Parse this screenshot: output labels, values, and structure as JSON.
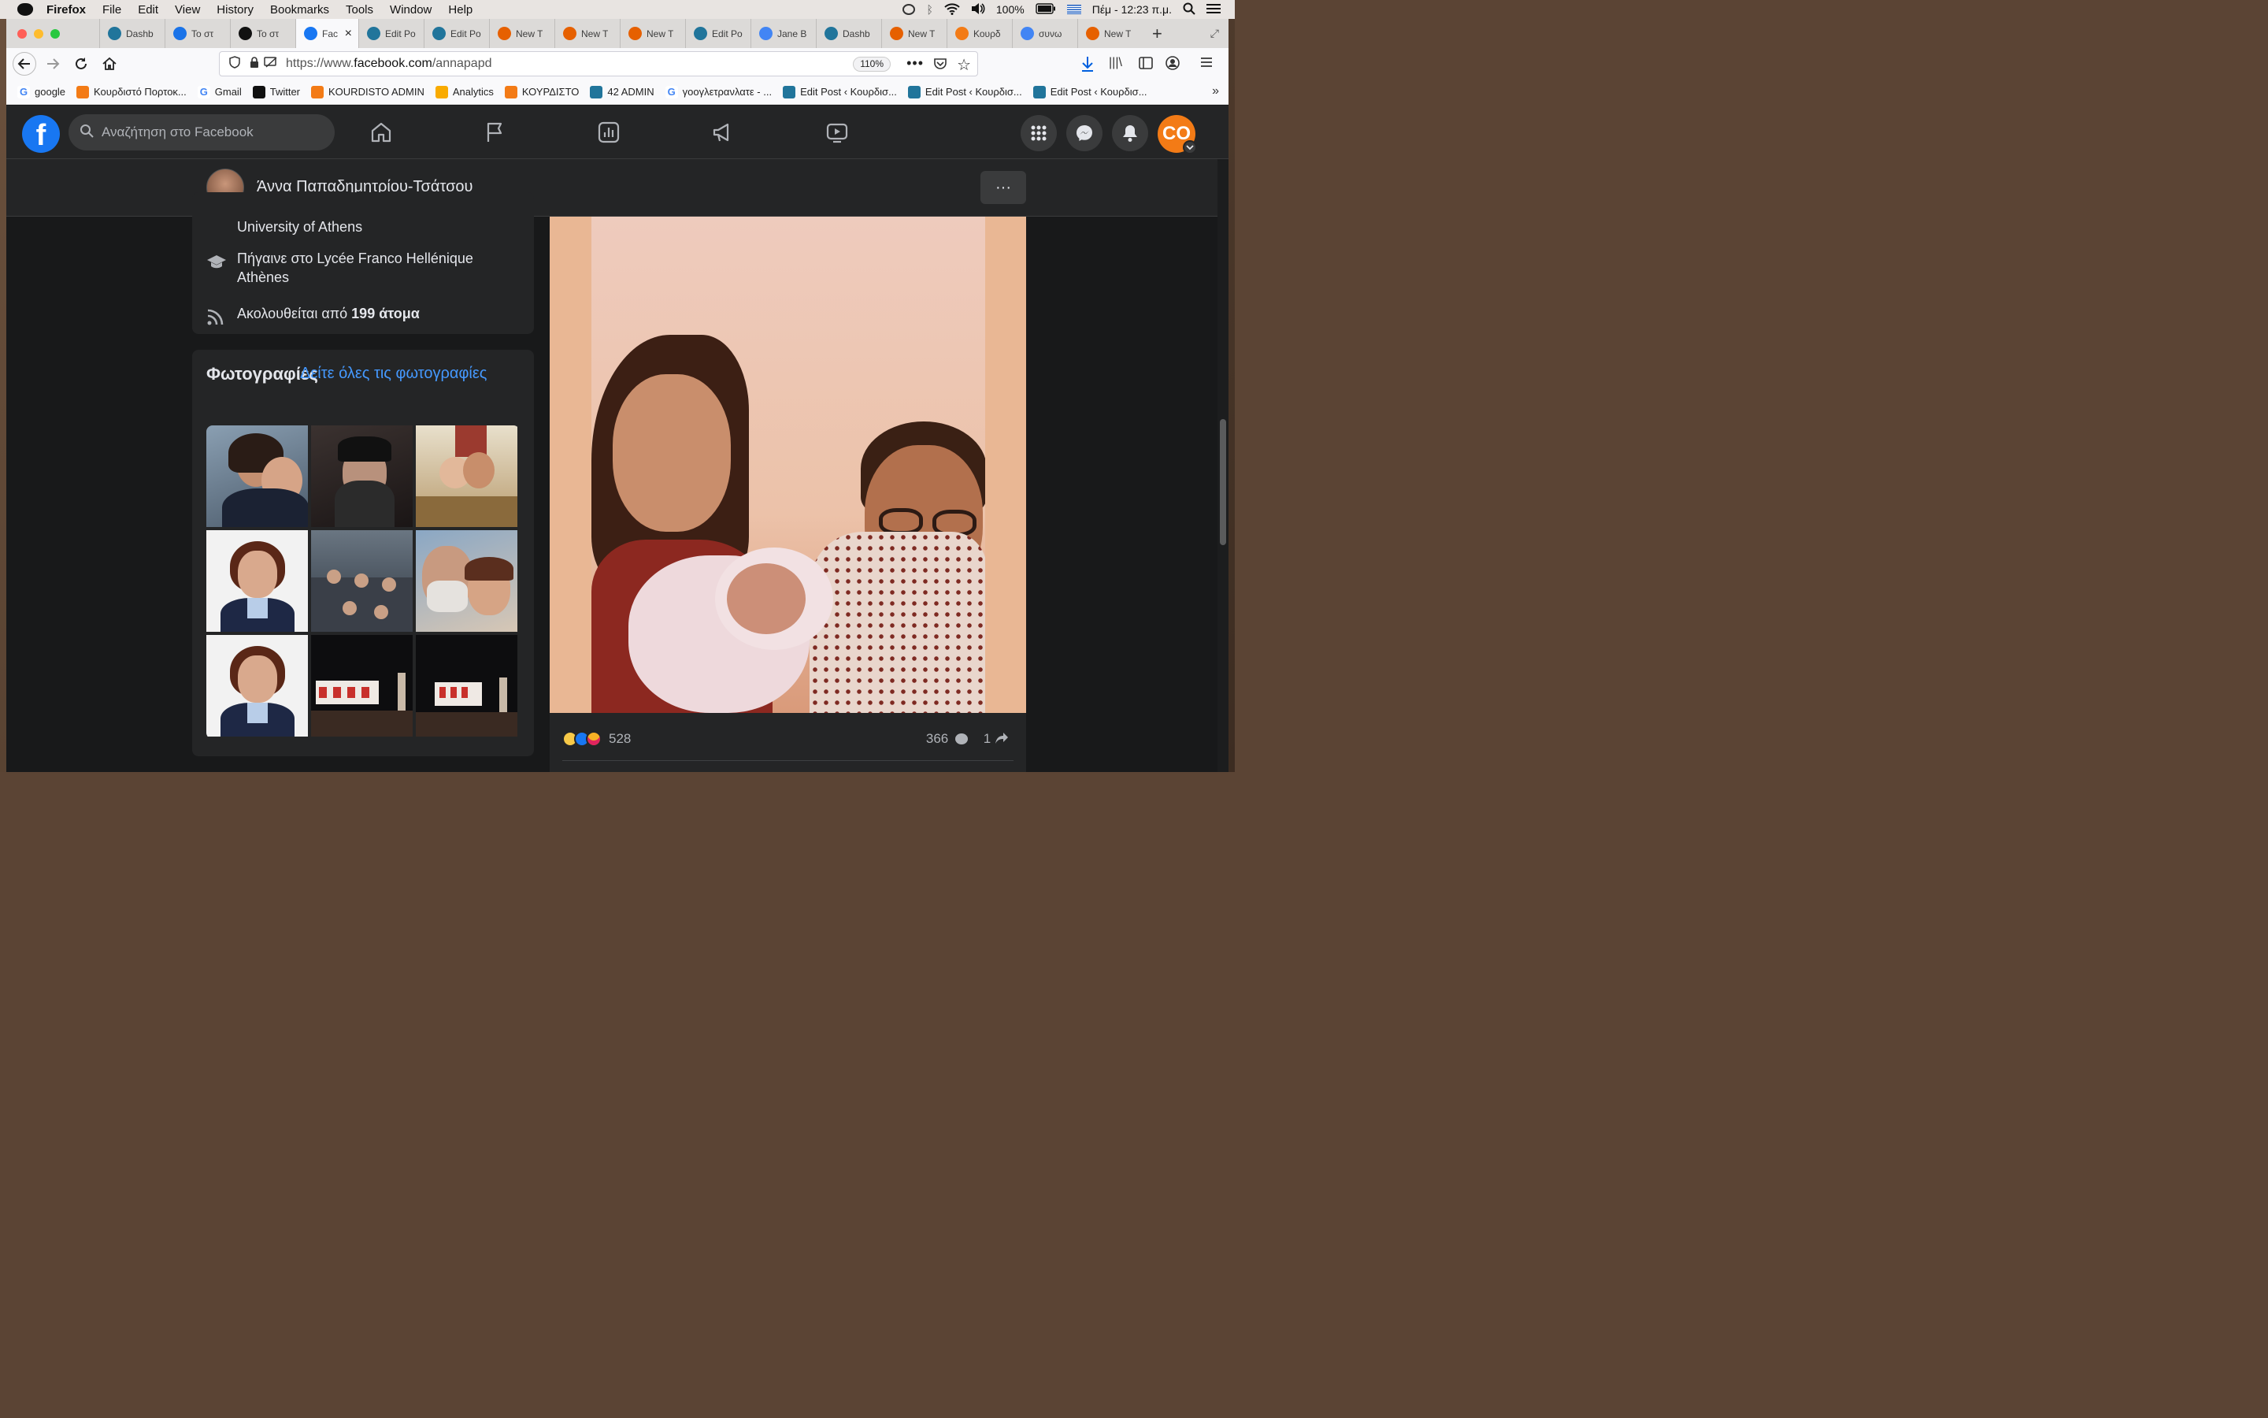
{
  "menubar": {
    "app": "Firefox",
    "items": [
      "File",
      "Edit",
      "View",
      "History",
      "Bookmarks",
      "Tools",
      "Window",
      "Help"
    ],
    "battery": "100%",
    "clock": "Πέμ - 12:23 π.μ."
  },
  "tabs": [
    {
      "label": "Dashb",
      "icon": "wordpress-icon",
      "color": "#21759b"
    },
    {
      "label": "Το στ",
      "icon": "play-icon",
      "color": "#1a73e8"
    },
    {
      "label": "Το στ",
      "icon": "tiktok-icon",
      "color": "#111111"
    },
    {
      "label": "Fac",
      "icon": "facebook-icon",
      "color": "#1877f2",
      "active": true
    },
    {
      "label": "Edit Po",
      "icon": "wordpress-icon",
      "color": "#21759b"
    },
    {
      "label": "Edit Po",
      "icon": "wordpress-icon",
      "color": "#21759b"
    },
    {
      "label": "New T",
      "icon": "firefox-icon",
      "color": "#e66000"
    },
    {
      "label": "New T",
      "icon": "firefox-icon",
      "color": "#e66000"
    },
    {
      "label": "New T",
      "icon": "firefox-icon",
      "color": "#e66000"
    },
    {
      "label": "Edit Po",
      "icon": "wordpress-icon",
      "color": "#21759b"
    },
    {
      "label": "Jane B",
      "icon": "google-icon",
      "color": "#4285f4"
    },
    {
      "label": "Dashb",
      "icon": "wordpress-icon",
      "color": "#21759b"
    },
    {
      "label": "New T",
      "icon": "firefox-icon",
      "color": "#e66000"
    },
    {
      "label": "Κουρδ",
      "icon": "co-icon",
      "color": "#f37b16"
    },
    {
      "label": "συνω",
      "icon": "google-icon",
      "color": "#4285f4"
    },
    {
      "label": "New T",
      "icon": "firefox-icon",
      "color": "#e66000"
    }
  ],
  "navbar": {
    "url_prefix": "https://www.",
    "url_host": "facebook.com",
    "url_path": "/annapapd",
    "zoom": "110%"
  },
  "bookmarks": [
    {
      "label": "google",
      "icon": "google-icon",
      "color": "#ffffff"
    },
    {
      "label": "Κουρδιστό Πορτοκ...",
      "icon": "co-icon",
      "color": "#f37b16"
    },
    {
      "label": "Gmail",
      "icon": "google-icon",
      "color": "#ffffff"
    },
    {
      "label": "Twitter",
      "icon": "x-icon",
      "color": "#111111"
    },
    {
      "label": "KOURDISTO ADMIN",
      "icon": "co-icon",
      "color": "#f37b16"
    },
    {
      "label": "Analytics",
      "icon": "analytics-icon",
      "color": "#f9ab00"
    },
    {
      "label": "ΚΟΥΡΔΙΣΤΟ",
      "icon": "co-icon",
      "color": "#f37b16"
    },
    {
      "label": "42 ADMIN",
      "icon": "wordpress-icon",
      "color": "#21759b"
    },
    {
      "label": "γοογλετρανλατε - ...",
      "icon": "google-icon",
      "color": "#ffffff"
    },
    {
      "label": "Edit Post ‹ Κουρδισ...",
      "icon": "wordpress-icon",
      "color": "#21759b"
    },
    {
      "label": "Edit Post ‹ Κουρδισ...",
      "icon": "wordpress-icon",
      "color": "#21759b"
    },
    {
      "label": "Edit Post ‹ Κουρδισ...",
      "icon": "wordpress-icon",
      "color": "#21759b"
    }
  ],
  "facebook": {
    "search_placeholder": "Αναζήτηση στο Facebook",
    "avatar_label": "CO",
    "profile_name": "Άννα Παπαδημητρίου-Τσάτσου",
    "more_label": "···",
    "intro": {
      "university_partial": "University of Athens",
      "school": "Πήγαινε στο Lycée Franco Hellénique Athènes",
      "followers_prefix": "Ακολουθείται από ",
      "followers_count": "199 άτομα"
    },
    "photos": {
      "title": "Φωτογραφίες",
      "see_all": "Δείτε όλες τις φωτογραφίες"
    },
    "post": {
      "reaction_count": "528",
      "comment_count": "366",
      "share_count": "1"
    }
  }
}
